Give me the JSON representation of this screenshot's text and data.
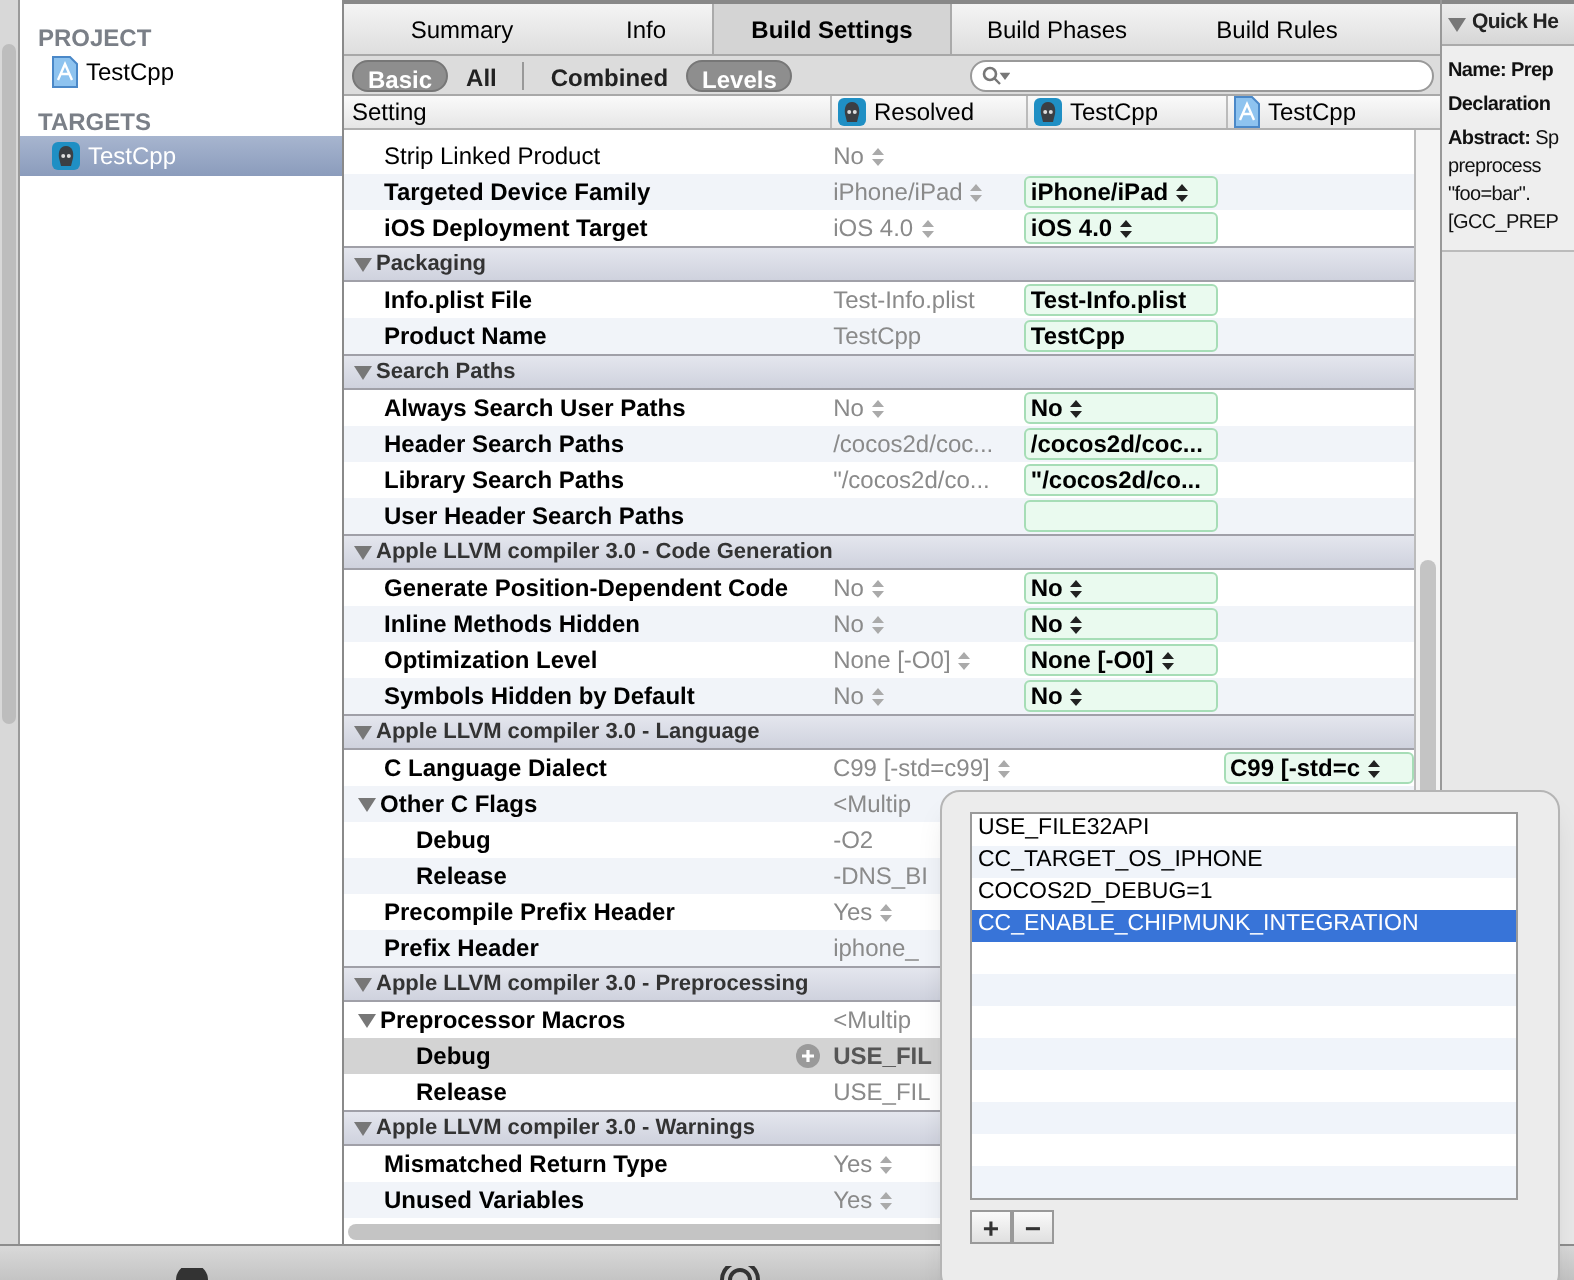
{
  "sidebar": {
    "sections": [
      {
        "title": "PROJECT",
        "items": [
          {
            "label": "TestCpp",
            "kind": "project",
            "selected": false
          }
        ]
      },
      {
        "title": "TARGETS",
        "items": [
          {
            "label": "TestCpp",
            "kind": "target",
            "selected": true
          }
        ]
      }
    ]
  },
  "tabs": [
    {
      "label": "Summary",
      "selected": false
    },
    {
      "label": "Info",
      "selected": false
    },
    {
      "label": "Build Settings",
      "selected": true
    },
    {
      "label": "Build Phases",
      "selected": false
    },
    {
      "label": "Build Rules",
      "selected": false
    }
  ],
  "filter_groups": [
    [
      {
        "label": "Basic",
        "selected": true
      },
      {
        "label": "All",
        "selected": false
      }
    ],
    [
      {
        "label": "Combined",
        "selected": false
      },
      {
        "label": "Levels",
        "selected": true
      }
    ]
  ],
  "columns": [
    {
      "label": "Setting"
    },
    {
      "label": "Resolved",
      "kind": "target"
    },
    {
      "label": "TestCpp",
      "kind": "target"
    },
    {
      "label": "TestCpp",
      "kind": "project"
    }
  ],
  "rows": [
    {
      "kind": "setting",
      "label": "Strip Linked Product",
      "customized": false,
      "selected": false,
      "resolved": "No",
      "resolved_stepper": true
    },
    {
      "kind": "setting",
      "label": "Targeted Device Family",
      "customized": true,
      "selected": false,
      "resolved": "iPhone/iPad",
      "resolved_stepper": true,
      "target": {
        "value": "iPhone/iPad",
        "stepper": true
      }
    },
    {
      "kind": "setting",
      "label": "iOS Deployment Target",
      "customized": true,
      "selected": false,
      "resolved": "iOS 4.0",
      "resolved_stepper": true,
      "target": {
        "value": "iOS 4.0",
        "stepper": true
      }
    },
    {
      "kind": "section",
      "label": "Packaging",
      "expanded": true
    },
    {
      "kind": "setting",
      "label": "Info.plist File",
      "customized": true,
      "selected": false,
      "resolved": "Test-Info.plist",
      "resolved_stepper": false,
      "target": {
        "value": "Test-Info.plist",
        "stepper": false
      }
    },
    {
      "kind": "setting",
      "label": "Product Name",
      "customized": true,
      "selected": false,
      "resolved": "TestCpp",
      "resolved_stepper": false,
      "target": {
        "value": "TestCpp",
        "stepper": false
      }
    },
    {
      "kind": "section",
      "label": "Search Paths",
      "expanded": true
    },
    {
      "kind": "setting",
      "label": "Always Search User Paths",
      "customized": true,
      "selected": false,
      "resolved": "No",
      "resolved_stepper": true,
      "target": {
        "value": "No",
        "stepper": true
      }
    },
    {
      "kind": "setting",
      "label": "Header Search Paths",
      "customized": true,
      "selected": false,
      "resolved": "/cocos2d/coc...",
      "resolved_stepper": false,
      "target": {
        "value": "/cocos2d/coc...",
        "stepper": false
      }
    },
    {
      "kind": "setting",
      "label": "Library Search Paths",
      "customized": true,
      "selected": false,
      "resolved": "\"/cocos2d/co...",
      "resolved_stepper": false,
      "target": {
        "value": "\"/cocos2d/co...",
        "stepper": false
      }
    },
    {
      "kind": "setting",
      "label": "User Header Search Paths",
      "customized": true,
      "selected": false,
      "resolved_stepper": false,
      "target": {
        "stepper": false
      }
    },
    {
      "kind": "section",
      "label": "Apple LLVM compiler 3.0 - Code Generation",
      "expanded": true
    },
    {
      "kind": "setting",
      "label": "Generate Position-Dependent Code",
      "customized": true,
      "selected": false,
      "resolved": "No",
      "resolved_stepper": true,
      "target": {
        "value": "No",
        "stepper": true
      }
    },
    {
      "kind": "setting",
      "label": "Inline Methods Hidden",
      "customized": true,
      "selected": false,
      "resolved": "No",
      "resolved_stepper": true,
      "target": {
        "value": "No",
        "stepper": true
      }
    },
    {
      "kind": "setting",
      "label": "Optimization Level",
      "customized": true,
      "selected": false,
      "resolved": "None [-O0]",
      "resolved_stepper": true,
      "target": {
        "value": "None [-O0]",
        "stepper": true
      }
    },
    {
      "kind": "setting",
      "label": "Symbols Hidden by Default",
      "customized": true,
      "selected": false,
      "resolved": "No",
      "resolved_stepper": true,
      "target": {
        "value": "No",
        "stepper": true
      }
    },
    {
      "kind": "section",
      "label": "Apple LLVM compiler 3.0 - Language",
      "expanded": true
    },
    {
      "kind": "setting",
      "label": "C Language Dialect",
      "customized": true,
      "selected": false,
      "resolved": "C99 [-std=c99]",
      "resolved_stepper": true,
      "project": {
        "value": "C99 [-std=c",
        "stepper": true
      }
    },
    {
      "kind": "setting",
      "label": "Other C Flags",
      "customized": true,
      "selected": false,
      "resolved": "<Multip",
      "resolved_stepper": false,
      "expanded": true,
      "children": [
        {
          "kind": "setting",
          "label": "Debug",
          "customized": true,
          "selected": false,
          "resolved": "-O2",
          "resolved_stepper": false
        },
        {
          "kind": "setting",
          "label": "Release",
          "customized": true,
          "selected": false,
          "resolved": "-DNS_BI",
          "resolved_stepper": false
        }
      ]
    },
    {
      "kind": "setting",
      "label": "Precompile Prefix Header",
      "customized": true,
      "selected": false,
      "resolved": "Yes",
      "resolved_stepper": true
    },
    {
      "kind": "setting",
      "label": "Prefix Header",
      "customized": true,
      "selected": false,
      "resolved": "iphone_",
      "resolved_stepper": false
    },
    {
      "kind": "section",
      "label": "Apple LLVM compiler 3.0 - Preprocessing",
      "expanded": true
    },
    {
      "kind": "setting",
      "label": "Preprocessor Macros",
      "customized": true,
      "selected": false,
      "resolved": "<Multip",
      "resolved_stepper": false,
      "expanded": true,
      "children": [
        {
          "kind": "setting",
          "label": "Debug",
          "customized": true,
          "selected": true,
          "resolved": "USE_FIL",
          "resolved_stepper": false
        },
        {
          "kind": "setting",
          "label": "Release",
          "customized": true,
          "selected": false,
          "resolved": "USE_FIL",
          "resolved_stepper": false
        }
      ]
    },
    {
      "kind": "section",
      "label": "Apple LLVM compiler 3.0 - Warnings",
      "expanded": true
    },
    {
      "kind": "setting",
      "label": "Mismatched Return Type",
      "customized": true,
      "selected": false,
      "resolved": "Yes",
      "resolved_stepper": true
    },
    {
      "kind": "setting",
      "label": "Unused Variables",
      "customized": true,
      "selected": false,
      "resolved": "Yes",
      "resolved_stepper": true
    }
  ],
  "quick_help": {
    "title": "Quick He",
    "expanded": true,
    "lines": [
      "**Name: Prep**",
      "**Declaration**",
      "**Abstract:** Sp",
      "preprocess",
      "\"foo=bar\".",
      "[GCC_PREP"
    ]
  },
  "popover": {
    "items": [
      {
        "label": "USE_FILE32API",
        "selected": false
      },
      {
        "label": "CC_TARGET_OS_IPHONE",
        "selected": false
      },
      {
        "label": "COCOS2D_DEBUG=1",
        "selected": false
      },
      {
        "label": "CC_ENABLE_CHIPMUNK_INTEGRATION",
        "selected": true
      }
    ],
    "buttons": [
      "+",
      "−"
    ]
  }
}
